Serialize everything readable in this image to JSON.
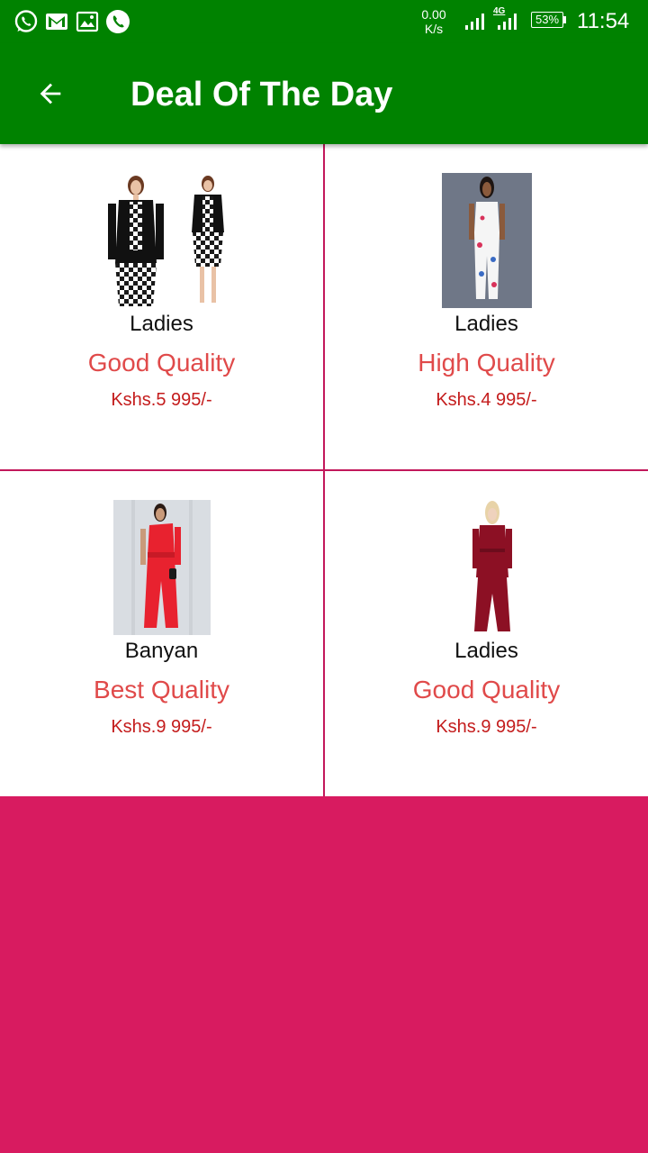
{
  "status_bar": {
    "network_speed_value": "0.00",
    "network_speed_unit": "K/s",
    "network_type": "4G",
    "battery": "53%",
    "time": "11:54",
    "icons": [
      "whatsapp-icon",
      "gmail-icon",
      "gallery-icon",
      "phone-call-icon",
      "signal-icon",
      "battery-icon"
    ]
  },
  "toolbar": {
    "title": "Deal Of The Day",
    "back_icon": "arrow-left-icon"
  },
  "products": [
    {
      "brand": "Ladies",
      "quality": "Good Quality",
      "price": "Kshs.5 995/-"
    },
    {
      "brand": "Ladies",
      "quality": "High Quality",
      "price": "Kshs.4 995/-"
    },
    {
      "brand": "Banyan",
      "quality": "Best Quality",
      "price": "Kshs.9 995/-"
    },
    {
      "brand": "Ladies",
      "quality": "Good Quality",
      "price": "Kshs.9 995/-"
    }
  ],
  "colors": {
    "app_bar": "#008200",
    "accent": "#d81b60",
    "divider": "#c2185b",
    "quality_text": "#e04a4a",
    "price_text": "#c41c1c"
  }
}
